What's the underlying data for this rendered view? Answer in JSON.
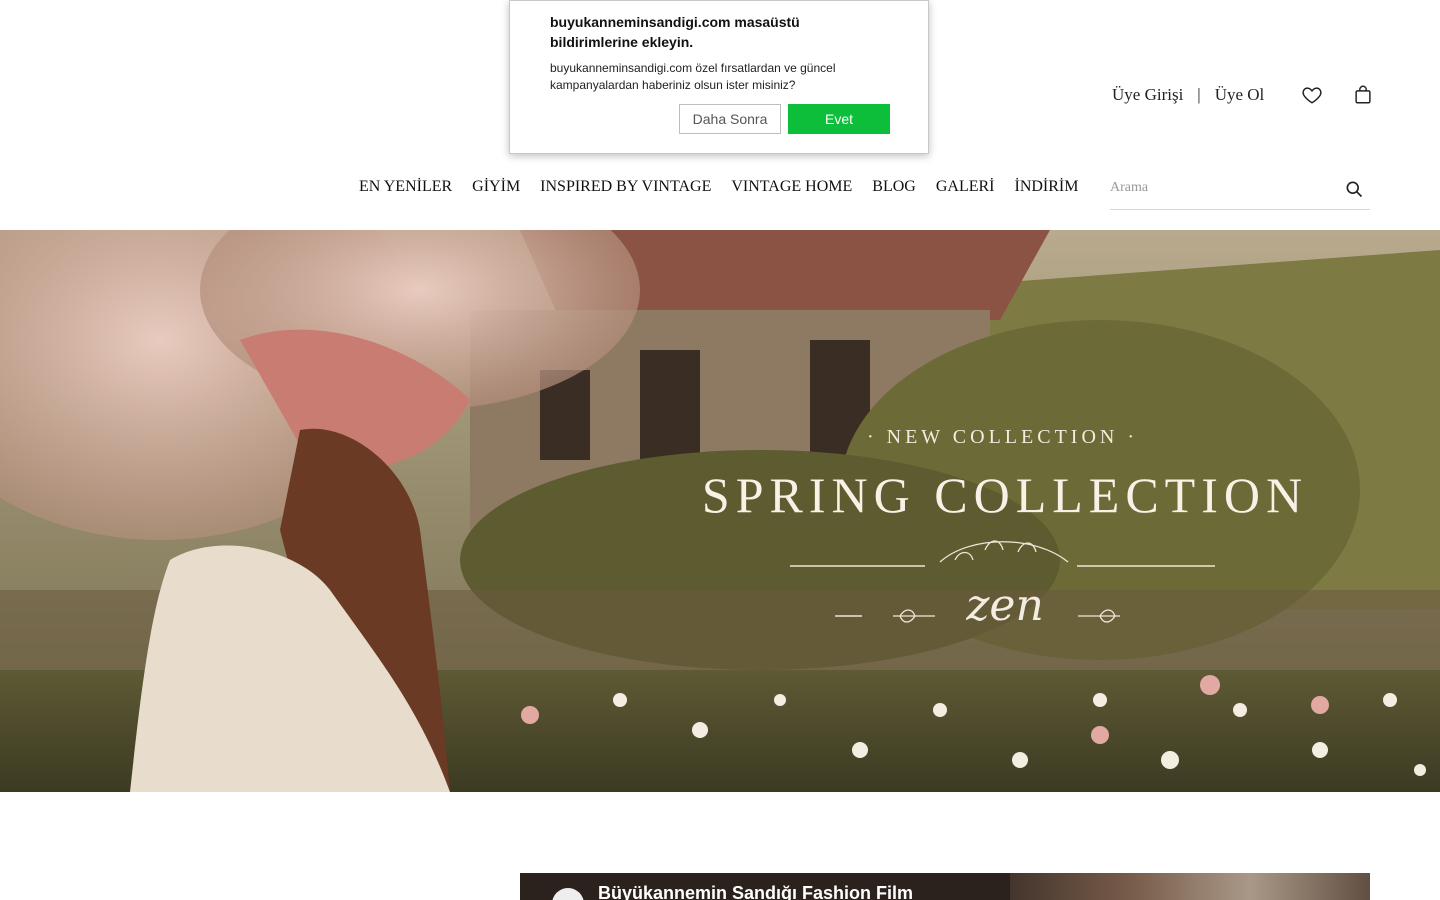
{
  "header": {
    "login_label": "Üye Girişi",
    "separator": "|",
    "register_label": "Üye Ol",
    "favorites_icon": "heart-icon",
    "cart_icon": "bag-icon"
  },
  "nav": {
    "items": [
      "EN YENİLER",
      "GİYİM",
      "INSPIRED BY VINTAGE",
      "VINTAGE HOME",
      "BLOG",
      "GALERİ",
      "İNDİRİM"
    ]
  },
  "search": {
    "placeholder": "Arama",
    "icon": "search-icon"
  },
  "hero": {
    "eyebrow": "· NEW COLLECTION ·",
    "headline": "SPRING COLLECTION",
    "script": "zen"
  },
  "notification": {
    "title": "buyukanneminsandigi.com masaüstü bildirimlerine ekleyin.",
    "message": "buyukanneminsandigi.com özel fırsatlardan ve güncel kampanyalardan haberiniz olsun ister misiniz?",
    "later_label": "Daha Sonra",
    "yes_label": "Evet",
    "yes_color": "#0cbe3a"
  },
  "video": {
    "title": "Büyükannemin Sandığı Fashion Film"
  }
}
